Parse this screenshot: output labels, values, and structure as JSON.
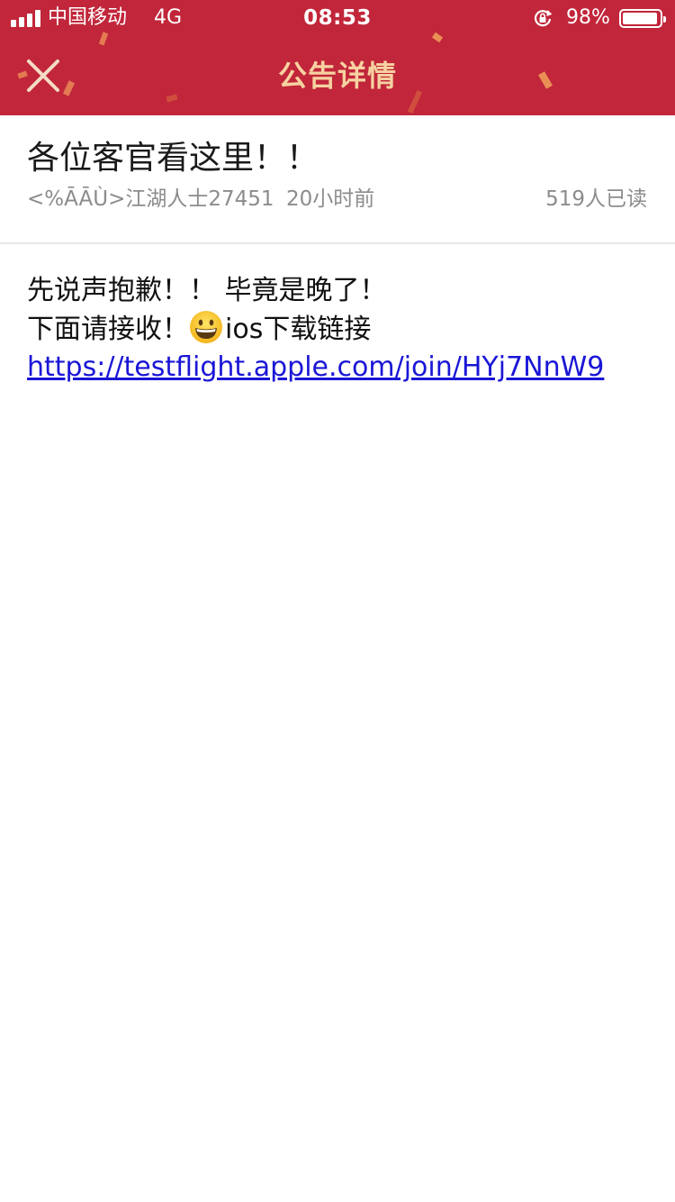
{
  "status_bar": {
    "carrier": "中国移动",
    "network": "4G",
    "time": "08:53",
    "battery_percent": "98%",
    "battery_level": 0.98,
    "icons": [
      "signal-icon",
      "rotation-lock-icon",
      "battery-icon"
    ]
  },
  "nav": {
    "title": "公告详情",
    "close_icon": "close-icon"
  },
  "post": {
    "title": "各位客官看这里！！",
    "author": "<%ĀĀÙ>江湖人士27451",
    "time": "20小时前",
    "reads": "519人已读",
    "line1": "先说声抱歉！！ 毕竟是晚了！",
    "line2_prefix": "下面请接收！",
    "emoji": "grinning-face-emoji",
    "line2_suffix": "ios下载链接",
    "link": "https://testflight.apple.com/join/HYj7NnW9"
  },
  "colors": {
    "header_bg": "#c1263a",
    "title_gold": "#f6d2a1",
    "link_blue": "#1a16d6",
    "meta_gray": "#8c8c8c"
  }
}
